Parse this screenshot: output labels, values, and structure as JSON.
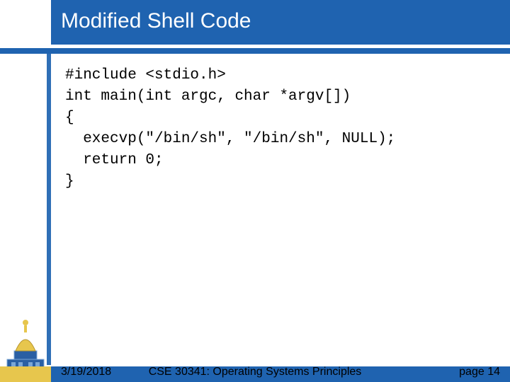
{
  "header": {
    "title": "Modified Shell Code"
  },
  "code": {
    "line1": "#include <stdio.h>",
    "line2": "int main(int argc, char *argv[])",
    "line3": "{",
    "line4": "  execvp(\"/bin/sh\", \"/bin/sh\", NULL);",
    "line5": "  return 0;",
    "line6": "}"
  },
  "footer": {
    "date": "3/19/2018",
    "center": "CSE 30341: Operating Systems Principles",
    "page": "page 14"
  }
}
